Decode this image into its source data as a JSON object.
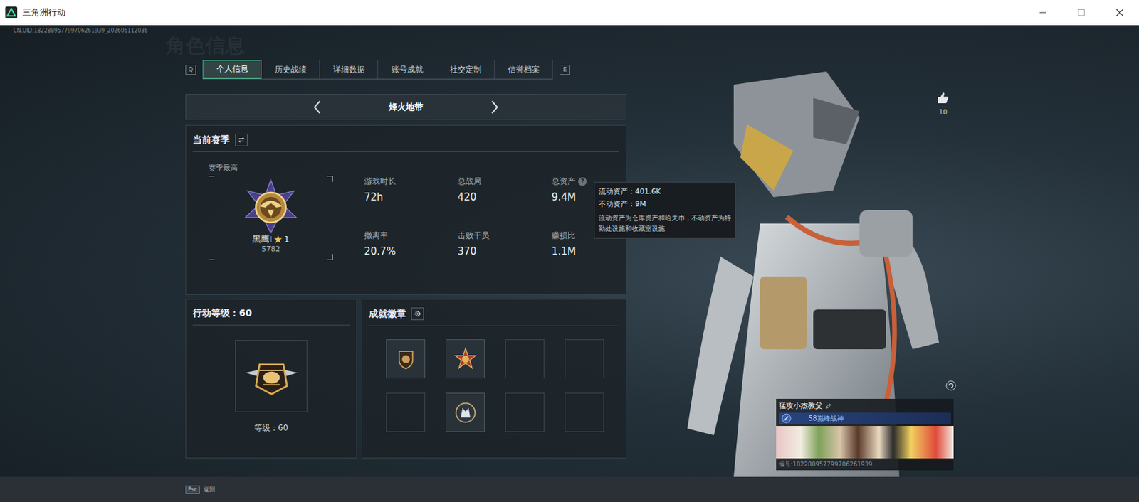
{
  "window": {
    "title": "三角洲行动"
  },
  "uid": "CN.UID:182288957799706261939_202606112036",
  "watermark": "角色信息",
  "tabs": {
    "prev_key": "Q",
    "next_key": "E",
    "items": [
      {
        "label": "个人信息",
        "selected": true
      },
      {
        "label": "历史战绩",
        "selected": false
      },
      {
        "label": "详细数据",
        "selected": false
      },
      {
        "label": "账号成就",
        "selected": false
      },
      {
        "label": "社交定制",
        "selected": false
      },
      {
        "label": "信誉档案",
        "selected": false
      }
    ]
  },
  "mode": {
    "label": "烽火地带"
  },
  "season": {
    "title": "当前赛季",
    "best_label": "赛季最高",
    "rank": "黑鹰I",
    "star_count": "1",
    "score": "5782",
    "stats": [
      {
        "label": "游戏时长",
        "value": "72h",
        "help": ""
      },
      {
        "label": "总战局",
        "value": "420",
        "help": ""
      },
      {
        "label": "总资产",
        "value": "9.4M",
        "help": "?"
      },
      {
        "label": "撤离率",
        "value": "20.7%",
        "help": ""
      },
      {
        "label": "击败干员",
        "value": "370",
        "help": ""
      },
      {
        "label": "赚损比",
        "value": "1.1M",
        "help": ""
      }
    ]
  },
  "tooltip": {
    "lines": [
      "流动资产：401.6K",
      "不动资产：9M"
    ],
    "note": "流动资产为仓库资产和哈夫币，不动资产为特勤处设施和收藏室设施"
  },
  "level": {
    "title": "行动等级：60",
    "label": "等级：60"
  },
  "achievements": {
    "title": "成就徽章",
    "slots": [
      {
        "kind": "shield"
      },
      {
        "kind": "medal"
      },
      {
        "kind": "empty"
      },
      {
        "kind": "empty"
      },
      {
        "kind": "empty"
      },
      {
        "kind": "wolf"
      },
      {
        "kind": "empty"
      },
      {
        "kind": "empty"
      }
    ]
  },
  "profile": {
    "likes": "10",
    "name": "猛攻小杰教父",
    "title": "58巅峰战神",
    "id": "编号:182288957799706261939"
  },
  "footer": {
    "key": "Esc",
    "label": "返回"
  }
}
